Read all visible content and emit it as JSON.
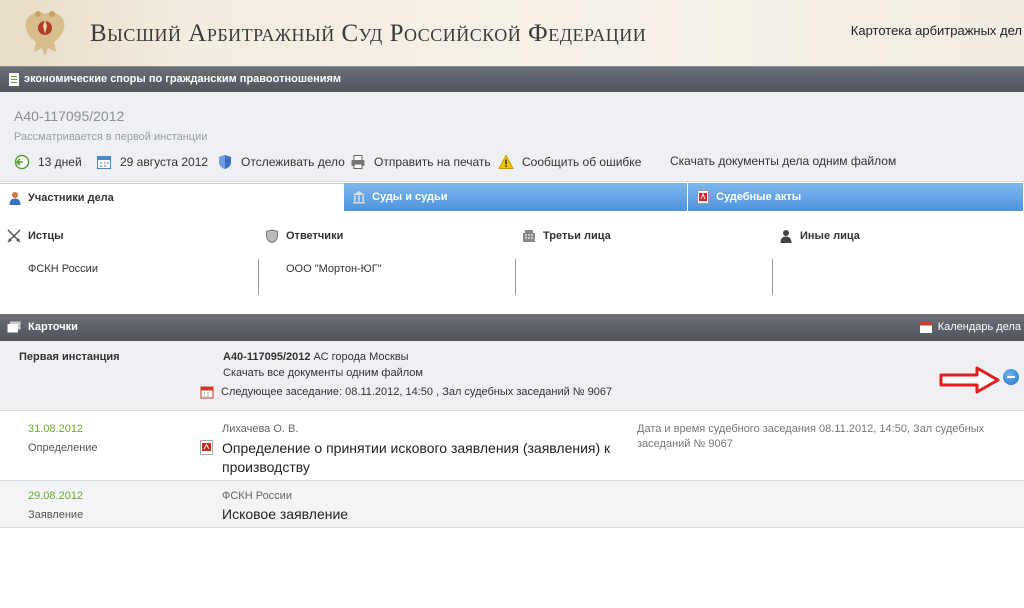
{
  "header": {
    "title": "Высший Арбитражный Суд Российской Федерации",
    "link": "Картотека арбитражных дел"
  },
  "category": {
    "label": "экономические споры по гражданским правоотношениям"
  },
  "case": {
    "number": "А40-117095/2012",
    "status": "Рассматривается в первой инстанции",
    "actions": {
      "days": "13 дней",
      "date": "29 августа 2012",
      "track": "Отслеживать дело",
      "print": "Отправить на печать",
      "report": "Сообщить об ошибке",
      "download": "Скачать документы дела одним файлом"
    }
  },
  "tabs": [
    {
      "label": "Участники дела"
    },
    {
      "label": "Суды и судьи"
    },
    {
      "label": "Судебные акты"
    }
  ],
  "parties": {
    "plaintiffs": {
      "header": "Истцы",
      "value": "ФСКН России"
    },
    "defendants": {
      "header": "Ответчики",
      "value": "ООО \"Мортон-ЮГ\""
    },
    "third": {
      "header": "Третьи лица",
      "value": ""
    },
    "other": {
      "header": "Иные лица",
      "value": ""
    }
  },
  "cards": {
    "title": "Карточки",
    "calendar": "Календарь дела"
  },
  "instance": {
    "title": "Первая инстанция",
    "case_number": "А40-117095/2012",
    "court": "АС города Москвы",
    "download": "Скачать все документы одним файлом",
    "next": "Следующее заседание: 08.11.2012, 14:50 , Зал судебных заседаний № 9067"
  },
  "documents": [
    {
      "date": "31.08.2012",
      "type": "Определение",
      "author": "Лихачева О. В.",
      "title": "Определение о принятии искового заявления (заявления) к производству",
      "note": "Дата и время судебного заседания 08.11.2012, 14:50, Зал судебных заседаний № 9067"
    },
    {
      "date": "29.08.2012",
      "type": "Заявление",
      "author": "ФСКН России",
      "title": "Исковое заявление",
      "note": ""
    }
  ],
  "colors": {
    "accent_blue": "#4f93dc",
    "date_green": "#6aa82e",
    "arrow_red": "#e01e1e"
  }
}
